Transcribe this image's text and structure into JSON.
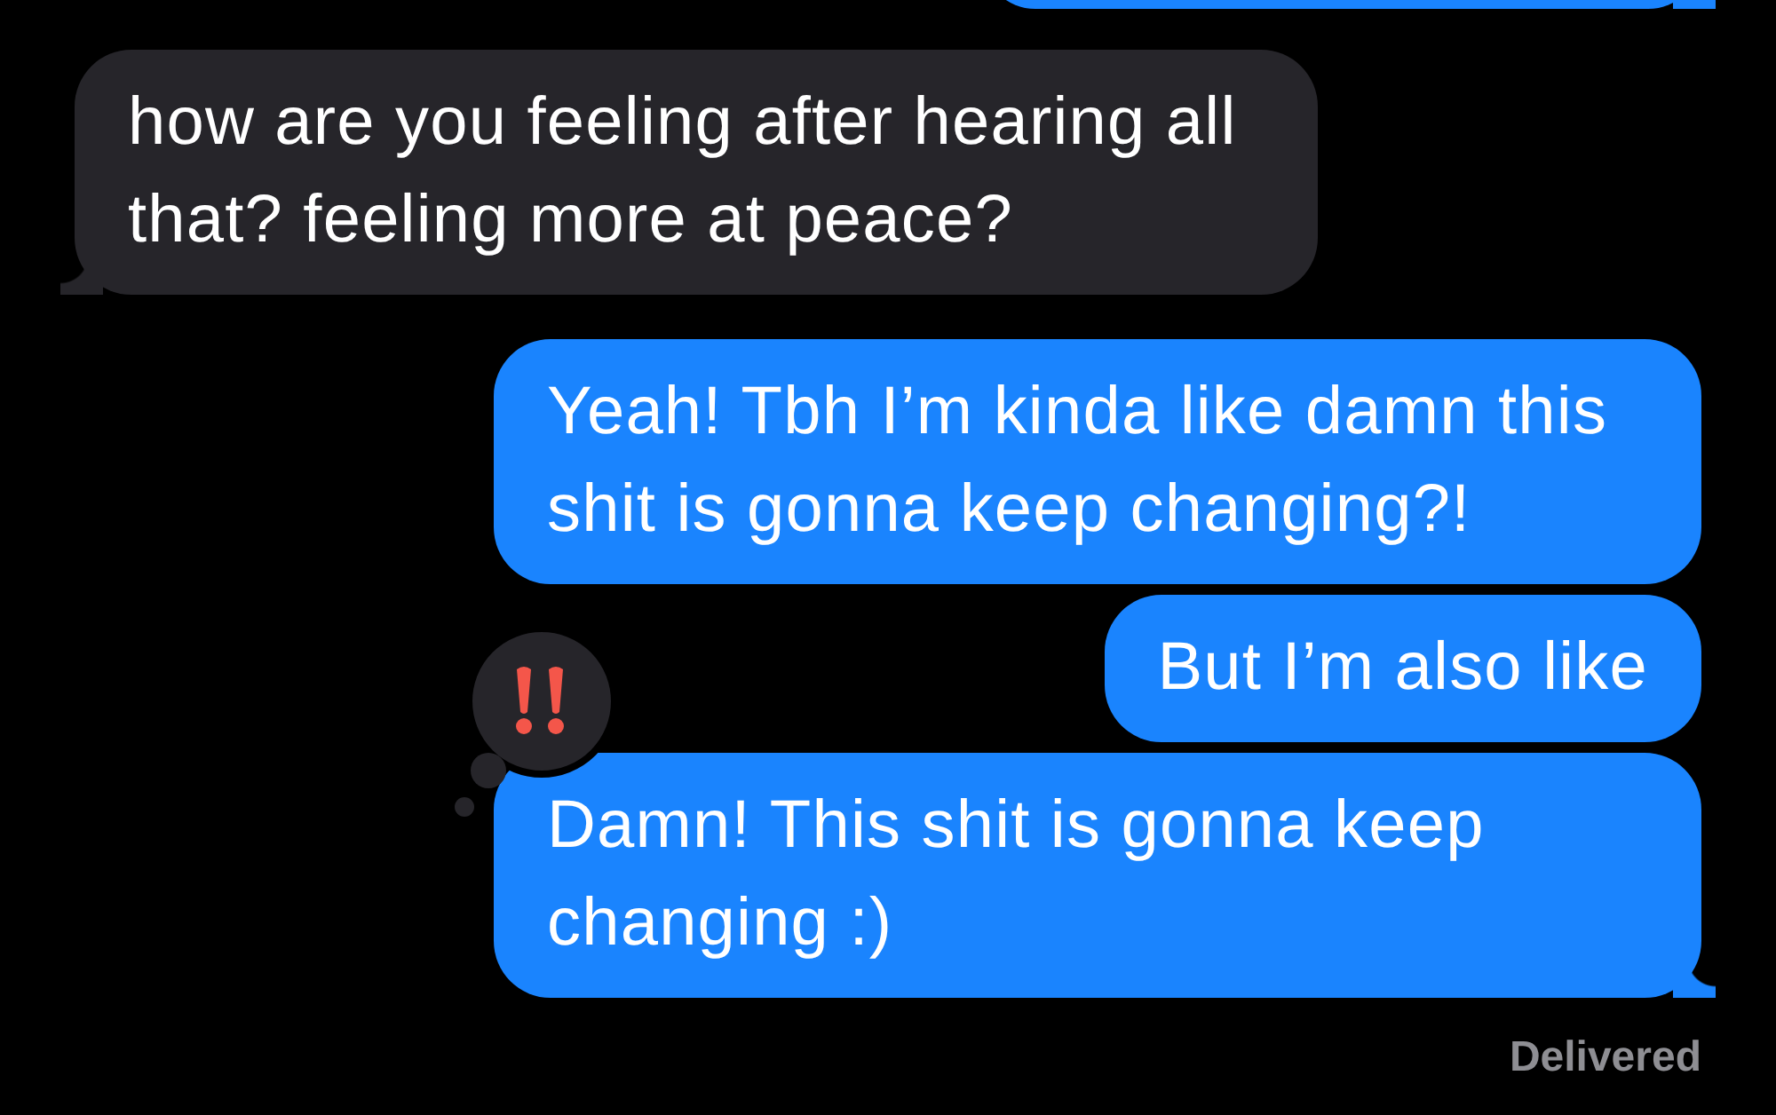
{
  "messages": [
    {
      "kind": "sent",
      "partial": true,
      "tail": true
    },
    {
      "kind": "received",
      "text": "how are you feeling after hearing all that? feeling more at peace?",
      "tail": true
    },
    {
      "kind": "sent",
      "text": "Yeah! Tbh I’m kinda like damn this shit is gonna keep changing?!",
      "tail": false
    },
    {
      "kind": "sent",
      "text": "But I’m also like",
      "tail": false
    },
    {
      "kind": "sent",
      "text": "Damn! This shit is gonna keep changing :)",
      "tail": true,
      "reaction": {
        "kind": "emphasize"
      }
    }
  ],
  "status": "Delivered"
}
